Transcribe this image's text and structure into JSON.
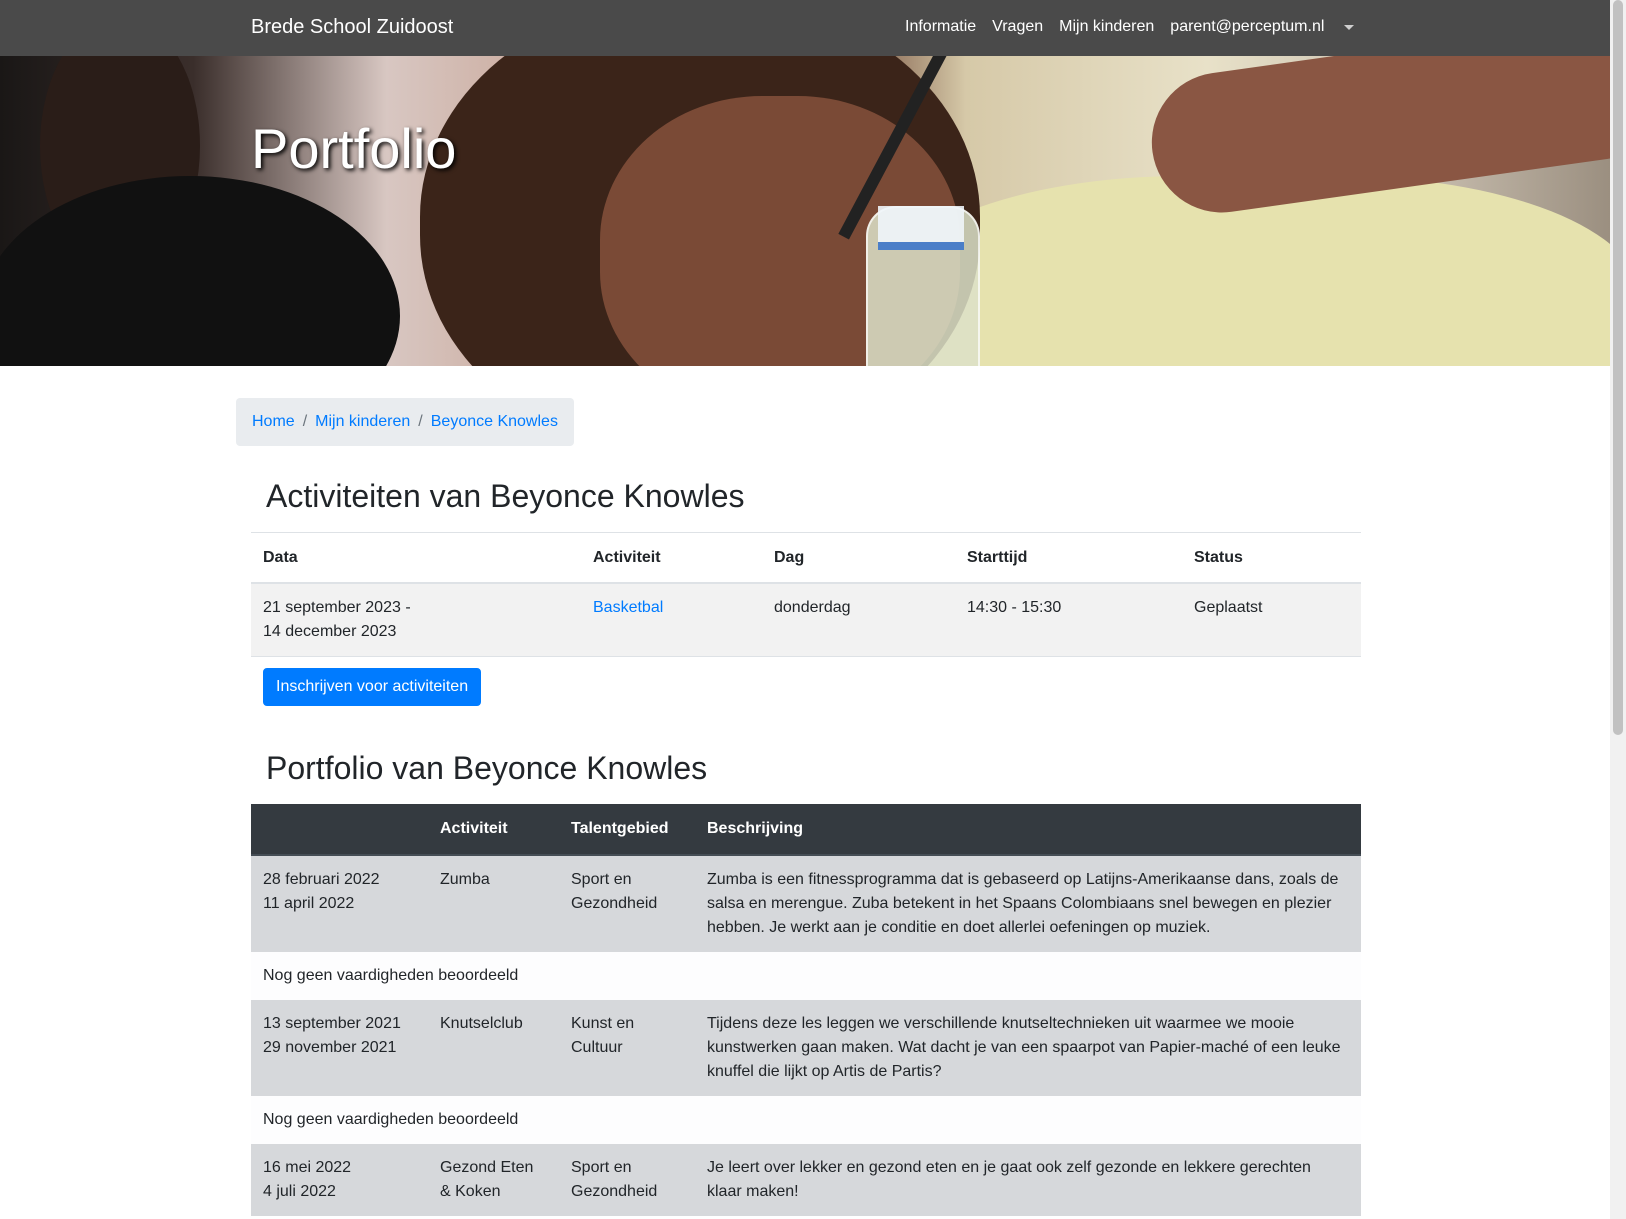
{
  "navbar": {
    "brand": "Brede School Zuidoost",
    "links": [
      "Informatie",
      "Vragen",
      "Mijn kinderen",
      "parent@perceptum.nl"
    ]
  },
  "hero": {
    "title": "Portfolio"
  },
  "breadcrumb": {
    "items": [
      "Home",
      "Mijn kinderen",
      "Beyonce Knowles"
    ]
  },
  "activities": {
    "heading": "Activiteiten van Beyonce Knowles",
    "columns": [
      "Data",
      "Activiteit",
      "Dag",
      "Starttijd",
      "Status"
    ],
    "rows": [
      {
        "date_start": "21 september 2023 -",
        "date_end": "14 december 2023",
        "activity": "Basketbal",
        "day": "donderdag",
        "time": "14:30 - 15:30",
        "status": "Geplaatst"
      }
    ],
    "button": "Inschrijven voor activiteiten"
  },
  "portfolio": {
    "heading": "Portfolio van Beyonce Knowles",
    "columns": [
      "",
      "Activiteit",
      "Talentgebied",
      "Beschrijving"
    ],
    "items": [
      {
        "date_start": "28 februari 2022",
        "date_end": "11 april 2022",
        "activity": "Zumba",
        "talent_line1": "Sport en",
        "talent_line2": "Gezondheid",
        "description": "Zumba is een fitnessprogramma dat is gebaseerd op Latijns-Amerikaanse dans, zoals de salsa en merengue. Zuba betekent in het Spaans Colombiaans snel bewegen en plezier hebben. Je werkt aan je conditie en doet allerlei oefeningen op muziek.",
        "note": "Nog geen vaardigheden beoordeeld"
      },
      {
        "date_start": "13 september 2021",
        "date_end": "29 november 2021",
        "activity": "Knutselclub",
        "talent_line1": "Kunst en",
        "talent_line2": "Cultuur",
        "description": "Tijdens deze les leggen we verschillende knutseltechnieken uit waarmee we mooie kunstwerken gaan maken. Wat dacht je van een spaarpot van Papier-maché of een leuke knuffel die lijkt op Artis de Partis?",
        "note": "Nog geen vaardigheden beoordeeld"
      },
      {
        "date_start": "16 mei 2022",
        "date_end": "4 juli 2022",
        "activity_line1": "Gezond Eten",
        "activity_line2": "& Koken",
        "talent_line1": "Sport en",
        "talent_line2": "Gezondheid",
        "description": "Je leert over lekker en gezond eten en je gaat ook zelf gezonde en lekkere gerechten klaar maken!"
      }
    ]
  }
}
